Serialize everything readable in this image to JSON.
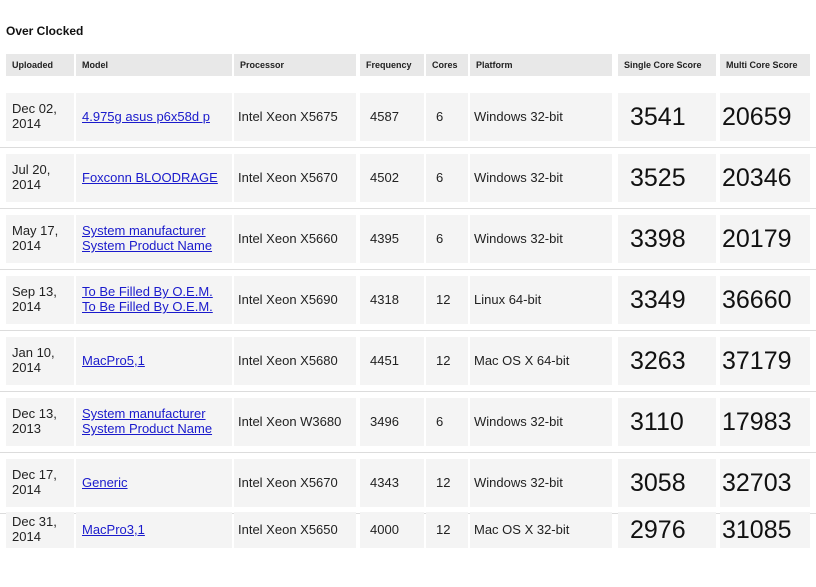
{
  "title": "Over Clocked",
  "columns": {
    "uploaded": "Uploaded",
    "model": "Model",
    "processor": "Processor",
    "frequency": "Frequency",
    "cores": "Cores",
    "platform": "Platform",
    "single": "Single Core Score",
    "multi": "Multi Core Score"
  },
  "rows": [
    {
      "date1": "Dec 02,",
      "date2": "2014",
      "model1": "4.975g asus p6x58d p",
      "model2": "",
      "processor": "Intel Xeon X5675",
      "frequency": "4587",
      "cores": "6",
      "platform": "Windows 32-bit",
      "single": "3541",
      "multi": "20659"
    },
    {
      "date1": "Jul 20,",
      "date2": "2014",
      "model1": "Foxconn BLOODRAGE",
      "model2": "",
      "processor": "Intel Xeon X5670",
      "frequency": "4502",
      "cores": "6",
      "platform": "Windows 32-bit",
      "single": "3525",
      "multi": "20346"
    },
    {
      "date1": "May 17,",
      "date2": "2014",
      "model1": "System manufacturer",
      "model2": "System Product Name",
      "processor": "Intel Xeon X5660",
      "frequency": "4395",
      "cores": "6",
      "platform": "Windows 32-bit",
      "single": "3398",
      "multi": "20179"
    },
    {
      "date1": "Sep 13,",
      "date2": "2014",
      "model1": "To Be Filled By O.E.M.",
      "model2": "To Be Filled By O.E.M.",
      "processor": "Intel Xeon X5690",
      "frequency": "4318",
      "cores": "12",
      "platform": "Linux 64-bit",
      "single": "3349",
      "multi": "36660"
    },
    {
      "date1": "Jan 10,",
      "date2": "2014",
      "model1": "MacPro5,1",
      "model2": "",
      "processor": "Intel Xeon X5680",
      "frequency": "4451",
      "cores": "12",
      "platform": "Mac OS X 64-bit",
      "single": "3263",
      "multi": "37179"
    },
    {
      "date1": "Dec 13,",
      "date2": "2013",
      "model1": "System manufacturer",
      "model2": "System Product Name",
      "processor": "Intel Xeon W3680",
      "frequency": "3496",
      "cores": "6",
      "platform": "Windows 32-bit",
      "single": "3110",
      "multi": "17983"
    },
    {
      "date1": "Dec 17,",
      "date2": "2014",
      "model1": "Generic",
      "model2": "",
      "processor": "Intel Xeon X5670",
      "frequency": "4343",
      "cores": "12",
      "platform": "Windows 32-bit",
      "single": "3058",
      "multi": "32703"
    },
    {
      "date1": "Dec 31,",
      "date2": "2014",
      "model1": "MacPro3,1",
      "model2": "",
      "processor": "Intel Xeon X5650",
      "frequency": "4000",
      "cores": "12",
      "platform": "Mac OS X 32-bit",
      "single": "2976",
      "multi": "31085"
    }
  ]
}
